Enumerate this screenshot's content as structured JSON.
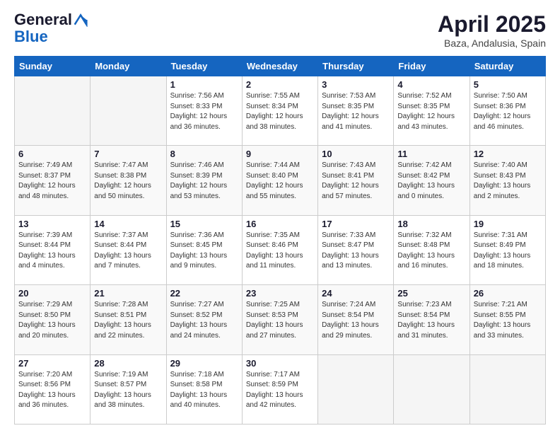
{
  "logo": {
    "general": "General",
    "blue": "Blue"
  },
  "header": {
    "month": "April 2025",
    "location": "Baza, Andalusia, Spain"
  },
  "weekdays": [
    "Sunday",
    "Monday",
    "Tuesday",
    "Wednesday",
    "Thursday",
    "Friday",
    "Saturday"
  ],
  "weeks": [
    [
      {
        "day": "",
        "info": ""
      },
      {
        "day": "",
        "info": ""
      },
      {
        "day": "1",
        "info": "Sunrise: 7:56 AM\nSunset: 8:33 PM\nDaylight: 12 hours and 36 minutes."
      },
      {
        "day": "2",
        "info": "Sunrise: 7:55 AM\nSunset: 8:34 PM\nDaylight: 12 hours and 38 minutes."
      },
      {
        "day": "3",
        "info": "Sunrise: 7:53 AM\nSunset: 8:35 PM\nDaylight: 12 hours and 41 minutes."
      },
      {
        "day": "4",
        "info": "Sunrise: 7:52 AM\nSunset: 8:35 PM\nDaylight: 12 hours and 43 minutes."
      },
      {
        "day": "5",
        "info": "Sunrise: 7:50 AM\nSunset: 8:36 PM\nDaylight: 12 hours and 46 minutes."
      }
    ],
    [
      {
        "day": "6",
        "info": "Sunrise: 7:49 AM\nSunset: 8:37 PM\nDaylight: 12 hours and 48 minutes."
      },
      {
        "day": "7",
        "info": "Sunrise: 7:47 AM\nSunset: 8:38 PM\nDaylight: 12 hours and 50 minutes."
      },
      {
        "day": "8",
        "info": "Sunrise: 7:46 AM\nSunset: 8:39 PM\nDaylight: 12 hours and 53 minutes."
      },
      {
        "day": "9",
        "info": "Sunrise: 7:44 AM\nSunset: 8:40 PM\nDaylight: 12 hours and 55 minutes."
      },
      {
        "day": "10",
        "info": "Sunrise: 7:43 AM\nSunset: 8:41 PM\nDaylight: 12 hours and 57 minutes."
      },
      {
        "day": "11",
        "info": "Sunrise: 7:42 AM\nSunset: 8:42 PM\nDaylight: 13 hours and 0 minutes."
      },
      {
        "day": "12",
        "info": "Sunrise: 7:40 AM\nSunset: 8:43 PM\nDaylight: 13 hours and 2 minutes."
      }
    ],
    [
      {
        "day": "13",
        "info": "Sunrise: 7:39 AM\nSunset: 8:44 PM\nDaylight: 13 hours and 4 minutes."
      },
      {
        "day": "14",
        "info": "Sunrise: 7:37 AM\nSunset: 8:44 PM\nDaylight: 13 hours and 7 minutes."
      },
      {
        "day": "15",
        "info": "Sunrise: 7:36 AM\nSunset: 8:45 PM\nDaylight: 13 hours and 9 minutes."
      },
      {
        "day": "16",
        "info": "Sunrise: 7:35 AM\nSunset: 8:46 PM\nDaylight: 13 hours and 11 minutes."
      },
      {
        "day": "17",
        "info": "Sunrise: 7:33 AM\nSunset: 8:47 PM\nDaylight: 13 hours and 13 minutes."
      },
      {
        "day": "18",
        "info": "Sunrise: 7:32 AM\nSunset: 8:48 PM\nDaylight: 13 hours and 16 minutes."
      },
      {
        "day": "19",
        "info": "Sunrise: 7:31 AM\nSunset: 8:49 PM\nDaylight: 13 hours and 18 minutes."
      }
    ],
    [
      {
        "day": "20",
        "info": "Sunrise: 7:29 AM\nSunset: 8:50 PM\nDaylight: 13 hours and 20 minutes."
      },
      {
        "day": "21",
        "info": "Sunrise: 7:28 AM\nSunset: 8:51 PM\nDaylight: 13 hours and 22 minutes."
      },
      {
        "day": "22",
        "info": "Sunrise: 7:27 AM\nSunset: 8:52 PM\nDaylight: 13 hours and 24 minutes."
      },
      {
        "day": "23",
        "info": "Sunrise: 7:25 AM\nSunset: 8:53 PM\nDaylight: 13 hours and 27 minutes."
      },
      {
        "day": "24",
        "info": "Sunrise: 7:24 AM\nSunset: 8:54 PM\nDaylight: 13 hours and 29 minutes."
      },
      {
        "day": "25",
        "info": "Sunrise: 7:23 AM\nSunset: 8:54 PM\nDaylight: 13 hours and 31 minutes."
      },
      {
        "day": "26",
        "info": "Sunrise: 7:21 AM\nSunset: 8:55 PM\nDaylight: 13 hours and 33 minutes."
      }
    ],
    [
      {
        "day": "27",
        "info": "Sunrise: 7:20 AM\nSunset: 8:56 PM\nDaylight: 13 hours and 36 minutes."
      },
      {
        "day": "28",
        "info": "Sunrise: 7:19 AM\nSunset: 8:57 PM\nDaylight: 13 hours and 38 minutes."
      },
      {
        "day": "29",
        "info": "Sunrise: 7:18 AM\nSunset: 8:58 PM\nDaylight: 13 hours and 40 minutes."
      },
      {
        "day": "30",
        "info": "Sunrise: 7:17 AM\nSunset: 8:59 PM\nDaylight: 13 hours and 42 minutes."
      },
      {
        "day": "",
        "info": ""
      },
      {
        "day": "",
        "info": ""
      },
      {
        "day": "",
        "info": ""
      }
    ]
  ]
}
